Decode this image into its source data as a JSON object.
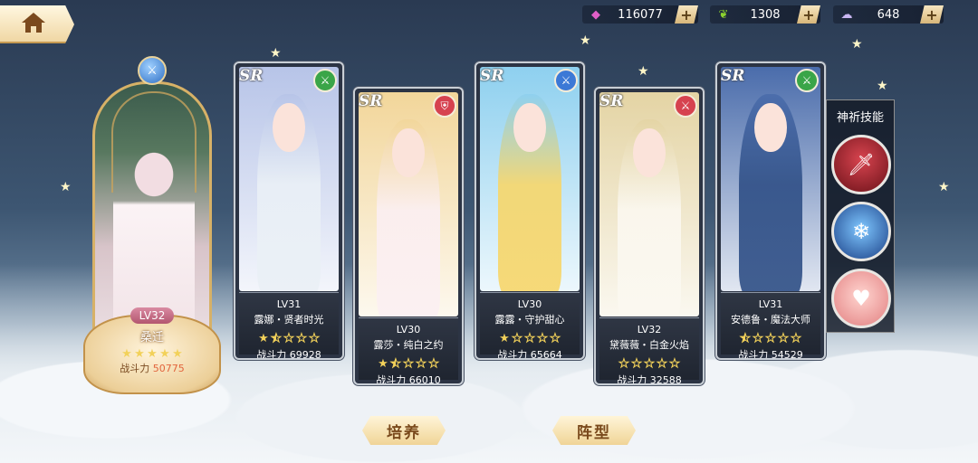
{
  "resources": [
    {
      "icon": "pink-gem-icon",
      "value": "116077"
    },
    {
      "icon": "green-leaf-icon",
      "value": "1308"
    },
    {
      "icon": "cloud-crystal-icon",
      "value": "648"
    }
  ],
  "featured": {
    "level": "LV32",
    "name": "桑迁",
    "stars": [
      1,
      1,
      1,
      1,
      1
    ],
    "power_label": "战斗力",
    "power": "50775",
    "element_icon": "sword-icon"
  },
  "cards": [
    {
      "rarity": "SR",
      "level": "LV31",
      "name": "露娜・贤者时光",
      "stars": [
        1,
        0.5,
        0,
        0,
        0
      ],
      "power": "战斗力 69928",
      "badge_icon": "sword-icon",
      "badge_color": "#3aa548",
      "art_color": "#b7c4e8",
      "dress_color": "#eaf0f6"
    },
    {
      "rarity": "SR",
      "level": "LV30",
      "name": "露莎・纯白之约",
      "stars": [
        1,
        0.5,
        0,
        0,
        0
      ],
      "power": "战斗力 66010",
      "badge_icon": "shield-icon",
      "badge_color": "#d6424f",
      "art_color": "#f2d69a",
      "dress_color": "#fbeff2"
    },
    {
      "rarity": "SR",
      "level": "LV30",
      "name": "露露・守护甜心",
      "stars": [
        1,
        0,
        0,
        0,
        0
      ],
      "power": "战斗力 65664",
      "badge_icon": "sword-icon",
      "badge_color": "#3c79d6",
      "art_color": "#8ed0ef",
      "dress_color": "#f7d66a"
    },
    {
      "rarity": "SR",
      "level": "LV32",
      "name": "黛薇薇・白金火焰",
      "stars": [
        0,
        0,
        0,
        0,
        0
      ],
      "power": "战斗力 32588",
      "badge_icon": "sword-icon",
      "badge_color": "#d6424f",
      "art_color": "#e4d4a4",
      "dress_color": "#fbf8f0"
    },
    {
      "rarity": "SR",
      "level": "LV31",
      "name": "安德鲁・魔法大师",
      "stars": [
        0.5,
        0,
        0,
        0,
        0
      ],
      "power": "战斗力 54529",
      "badge_icon": "sword-icon",
      "badge_color": "#3aa548",
      "art_color": "#4a6cab",
      "dress_color": "#2f4f86"
    }
  ],
  "skills": {
    "title": "神祈技能",
    "items": [
      {
        "icon": "flame-sword-icon",
        "color": "#a3222e"
      },
      {
        "icon": "snowflake-icon",
        "color": "#2c6ec4"
      },
      {
        "icon": "heart-shield-icon",
        "color": "#f0a4a4"
      }
    ]
  },
  "buttons": {
    "train": "培养",
    "formation": "阵型"
  }
}
